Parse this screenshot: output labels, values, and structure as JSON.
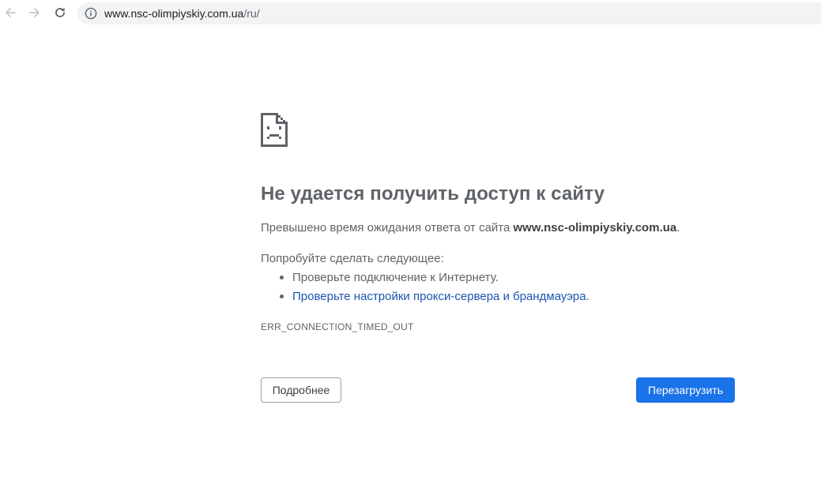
{
  "browser": {
    "url_host": "www.nsc-olimpiyskiy.com.ua",
    "url_path": "/ru/",
    "icons": {
      "back": "arrow-left-icon",
      "forward": "arrow-right-icon",
      "reload": "reload-icon",
      "info": "info-icon"
    }
  },
  "error_page": {
    "icon": "sad-document-icon",
    "title": "Не удается получить доступ к сайту",
    "description_prefix": "Превышено время ожидания ответа от сайта ",
    "description_host": "www.nsc-olimpiyskiy.com.ua",
    "description_suffix": ".",
    "try_label": "Попробуйте сделать следующее:",
    "suggestions": [
      {
        "text": "Проверьте подключение к Интернету."
      },
      {
        "link_text": "Проверьте настройки прокси-сервера и брандмауэра",
        "suffix": "."
      }
    ],
    "error_code": "ERR_CONNECTION_TIMED_OUT",
    "details_button": "Подробнее",
    "reload_button": "Перезагрузить"
  },
  "colors": {
    "accent": "#1a73e8",
    "link": "#1a55b0",
    "text": "#5f6368",
    "omnibox_bg": "#f1f3f4"
  }
}
